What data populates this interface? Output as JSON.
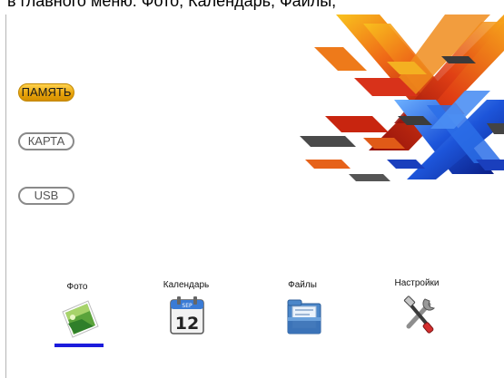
{
  "caption": {
    "text": "в главного меню: Фото, Календарь, Файлы,"
  },
  "sources": {
    "items": [
      {
        "label": "ПАМЯТЬ",
        "state": "active"
      },
      {
        "label": "КАРТА",
        "state": "idle"
      },
      {
        "label": "USB",
        "state": "idle"
      }
    ]
  },
  "nav": {
    "items": [
      {
        "label": "Фото",
        "icon": "photo-icon",
        "selected": true
      },
      {
        "label": "Календарь",
        "icon": "calendar-icon",
        "selected": false
      },
      {
        "label": "Файлы",
        "icon": "files-icon",
        "selected": false
      },
      {
        "label": "Настройки",
        "icon": "settings-icon",
        "selected": false
      }
    ]
  },
  "calendar_icon": {
    "month": "SEP",
    "day": "12"
  },
  "colors": {
    "active_source": "#f2b51c",
    "selection_underline": "#1b1bdc",
    "banner_warm": "#e8451a",
    "banner_cool": "#1b4fd8"
  }
}
